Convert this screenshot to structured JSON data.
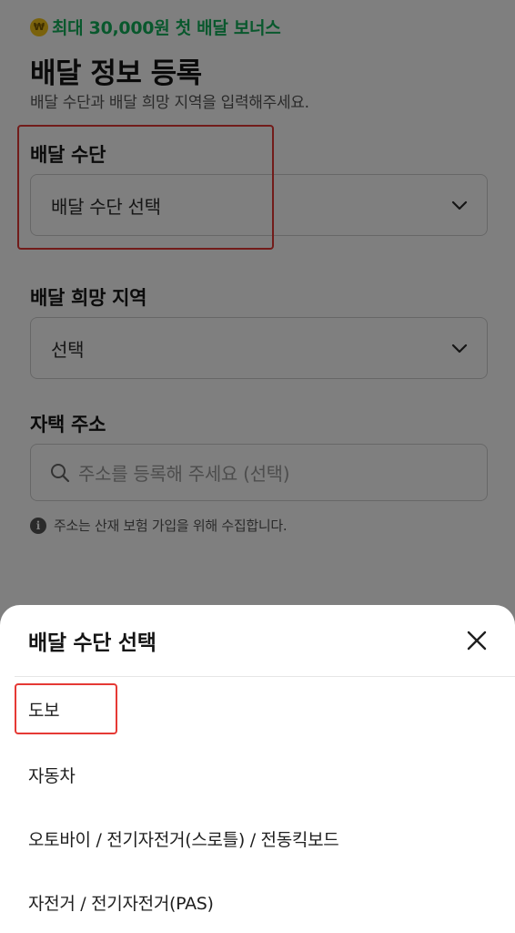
{
  "bonus": {
    "icon": "won-coin-icon",
    "coin_glyph": "₩",
    "text": "최대 30,000원 첫 배달 보너스",
    "color": "#12b15a"
  },
  "header": {
    "title": "배달 정보 등록",
    "subtitle": "배달 수단과 배달 희망 지역을 입력해주세요."
  },
  "form": {
    "vehicle": {
      "label": "배달 수단",
      "value": "배달 수단 선택"
    },
    "region": {
      "label": "배달 희망 지역",
      "value": "선택"
    },
    "address": {
      "label": "자택 주소",
      "placeholder": "주소를 등록해 주세요 (선택)"
    },
    "info": {
      "glyph": "i",
      "text": "주소는 산재 보험 가입을 위해 수집합니다."
    }
  },
  "sheet": {
    "title": "배달 수단 선택",
    "options": [
      "도보",
      "자동차",
      "오토바이 / 전기자전거(스로틀) / 전동킥보드",
      "자전거 / 전기자전거(PAS)"
    ]
  },
  "colors": {
    "highlight": "#e53935",
    "overlay": "rgba(0,0,0,0.5)"
  }
}
